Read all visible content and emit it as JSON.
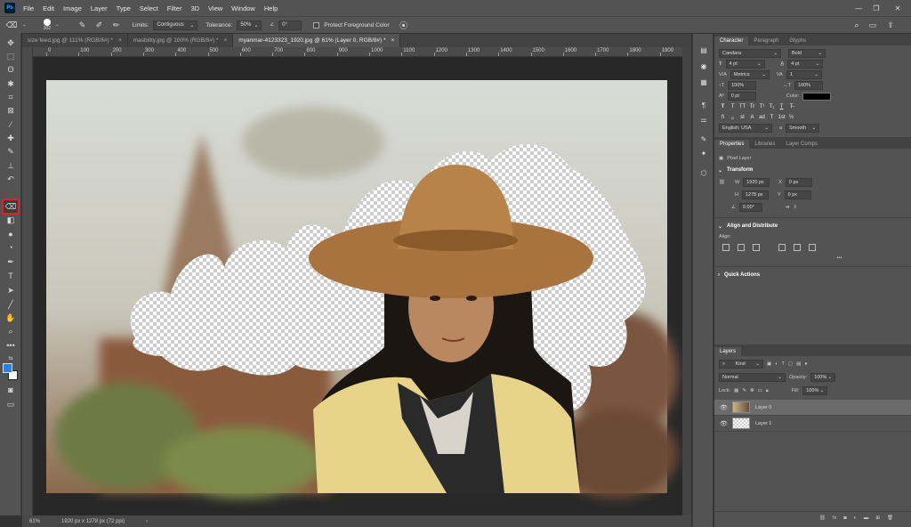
{
  "app": {
    "logo": "Ps"
  },
  "menu": [
    "File",
    "Edit",
    "Image",
    "Layer",
    "Type",
    "Select",
    "Filter",
    "3D",
    "View",
    "Window",
    "Help"
  ],
  "window_controls": [
    "—",
    "❐",
    "✕"
  ],
  "options": {
    "brush_size": "102",
    "limits_label": "Limits:",
    "limits_value": "Contiguous",
    "tolerance_label": "Tolerance:",
    "tolerance_value": "50%",
    "angle_value": "0°",
    "protect_label": "Protect Foreground Color"
  },
  "tabs": [
    {
      "label": "size feed.jpg @ 111% (RGB/8#) *",
      "close": "×"
    },
    {
      "label": "masbility.jpg @ 100% (RGB/8#) *",
      "close": "×"
    },
    {
      "label": "myanmar-4123323_1920.jpg @ 61% (Layer 0, RGB/8#) *",
      "close": "×"
    }
  ],
  "ruler": [
    "0",
    "100",
    "200",
    "300",
    "400",
    "500",
    "600",
    "700",
    "800",
    "900",
    "1000",
    "1100",
    "1200",
    "1300",
    "1400",
    "1500",
    "1600",
    "1700",
    "1800",
    "1900"
  ],
  "status": {
    "zoom": "61%",
    "doc_info": "1920 px x 1278 px (72 ppi)"
  },
  "colors": {
    "foreground": "#2d7fe8",
    "background": "#ffffff",
    "highlight": "#e0202a"
  },
  "character": {
    "tabs": [
      "Character",
      "Paragraph",
      "Glyphs"
    ],
    "font_family": "Candara",
    "font_style": "Bold",
    "size": "4 pt",
    "leading": "4 pt",
    "kerning": "Metrics",
    "tracking": "1",
    "vscale": "100%",
    "hscale": "100%",
    "baseline": "0 pt",
    "color_label": "Color:",
    "format_buttons": [
      "T",
      "T",
      "TT",
      "Tr",
      "T¹",
      "T₁",
      "T",
      "T̶"
    ],
    "opentype_buttons": [
      "fi",
      "ℴ",
      "st",
      "A",
      "ad",
      "T",
      "1st",
      "½"
    ],
    "language": "English: USA",
    "aa_a": "a",
    "antialias": "Smooth"
  },
  "properties": {
    "tabs": [
      "Properties",
      "Libraries",
      "Layer Comps"
    ],
    "kind": "Pixel Layer",
    "transform_title": "Transform",
    "w_label": "W",
    "w": "1920 px",
    "h_label": "H",
    "h": "1278 px",
    "x_label": "X",
    "x": "0 px",
    "y_label": "Y",
    "y": "0 px",
    "angle": "0.00°",
    "align_title": "Align and Distribute",
    "align_label": "Align:",
    "more": "•••",
    "quick_actions": "Quick Actions"
  },
  "layers": {
    "tab": "Layers",
    "filter": "Kind",
    "blend_mode": "Normal",
    "opacity_label": "Opacity:",
    "opacity": "100%",
    "lock_label": "Lock:",
    "fill_label": "Fill:",
    "fill": "100%",
    "items": [
      {
        "name": "Layer 0",
        "visible": true,
        "selected": true
      },
      {
        "name": "Layer 1",
        "visible": true,
        "selected": false
      }
    ],
    "footer_icons": [
      "link-icon",
      "fx-icon",
      "mask-icon",
      "adjustment-icon",
      "group-icon",
      "new-layer-icon",
      "trash-icon"
    ]
  }
}
